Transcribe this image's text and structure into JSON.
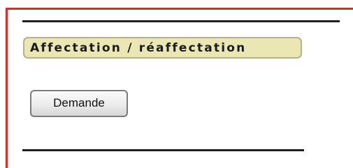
{
  "section": {
    "title": "Affectation / réaffectation"
  },
  "actions": {
    "request_label": "Demande"
  },
  "colors": {
    "frame": "#e8251f",
    "rule": "#1f1f1f",
    "title_background": "#ebe7b4",
    "title_border": "#b9b27f"
  }
}
